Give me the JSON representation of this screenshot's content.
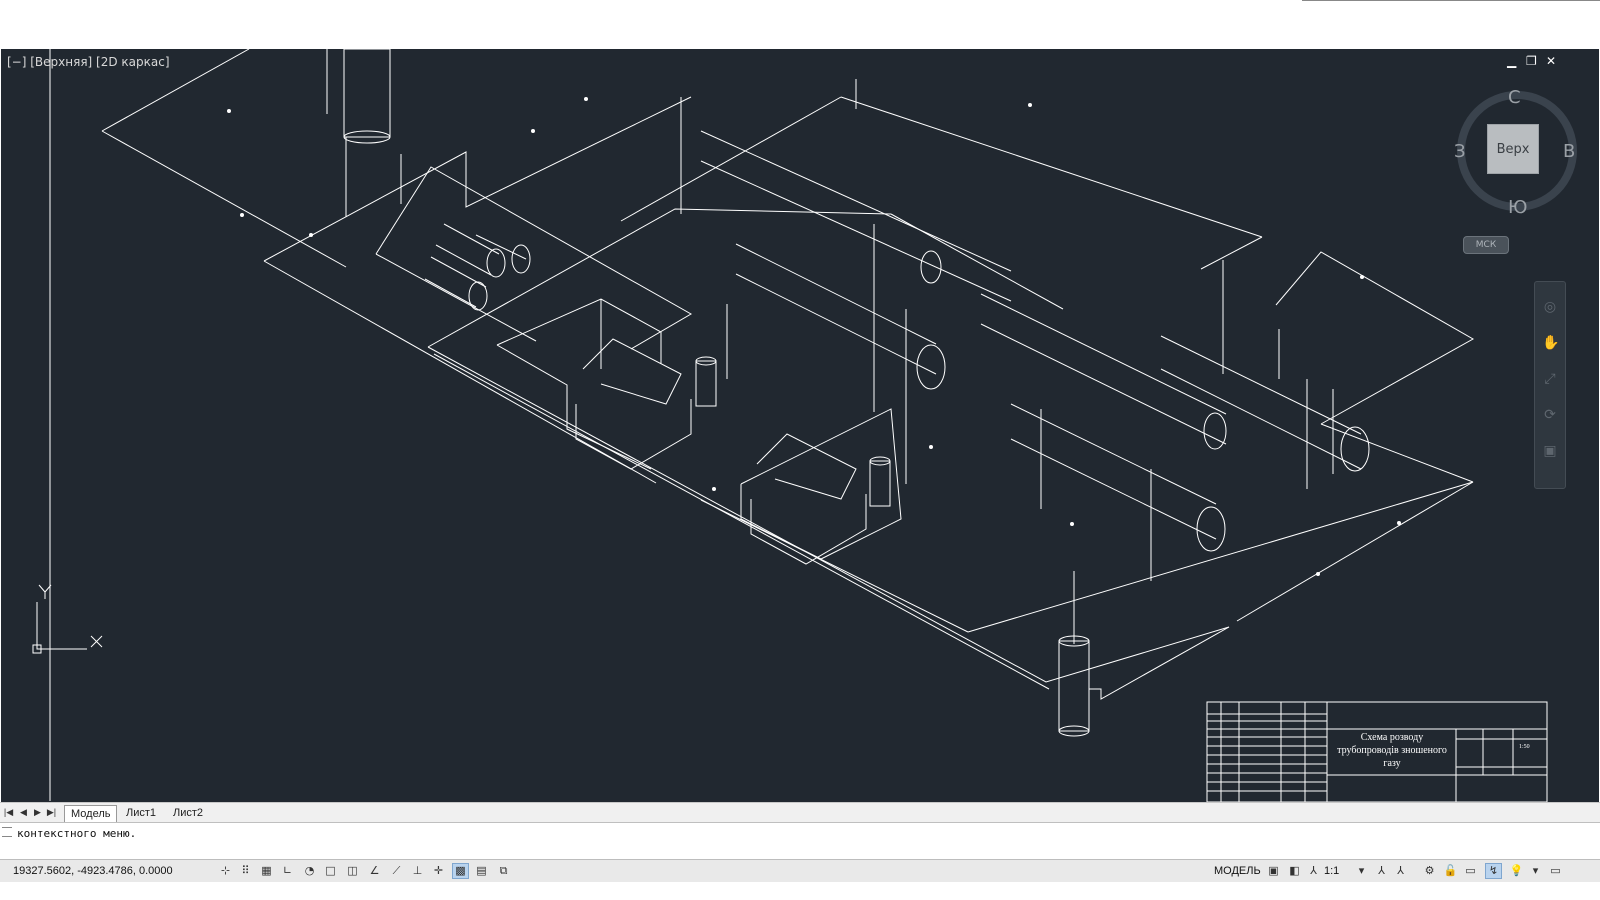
{
  "viewport": {
    "label": "[−] [Верхняя] [2D каркас]",
    "window_buttons": {
      "minimize": "▁",
      "restore": "❐",
      "close": "✕"
    },
    "background": "#212830",
    "line_color": "#ffffff"
  },
  "viewcube": {
    "face": "Верх",
    "north": "С",
    "south": "Ю",
    "east": "В",
    "west": "З",
    "ucs": "МСК"
  },
  "ucs_icon": {
    "x_label": "X",
    "y_label": "Y"
  },
  "title_block": {
    "drawing_title": "Схема розводу трубопроводів зношеного газу",
    "sheet_number": "1:50"
  },
  "tabs": {
    "items": [
      {
        "label": "Модель",
        "active": true
      },
      {
        "label": "Лист1",
        "active": false
      },
      {
        "label": "Лист2",
        "active": false
      }
    ]
  },
  "command_line": {
    "text": "контекстного меню."
  },
  "status_bar": {
    "coordinates": "19327.5602, -4923.4786, 0.0000",
    "model_label": "МОДЕЛЬ",
    "annotation_scale": "1:1"
  }
}
